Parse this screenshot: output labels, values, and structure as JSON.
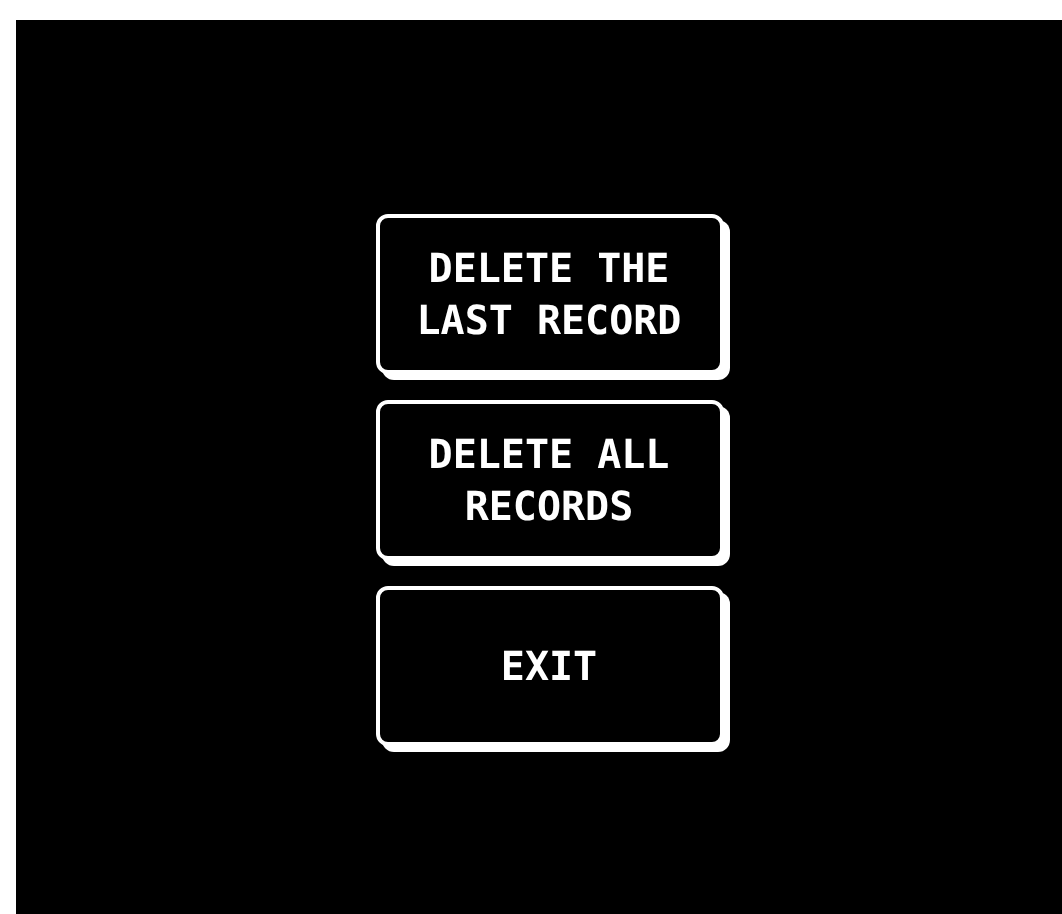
{
  "buttons": [
    {
      "label": "DELETE THE LAST RECORD"
    },
    {
      "label": "DELETE ALL RECORDS"
    },
    {
      "label": "EXIT"
    }
  ]
}
